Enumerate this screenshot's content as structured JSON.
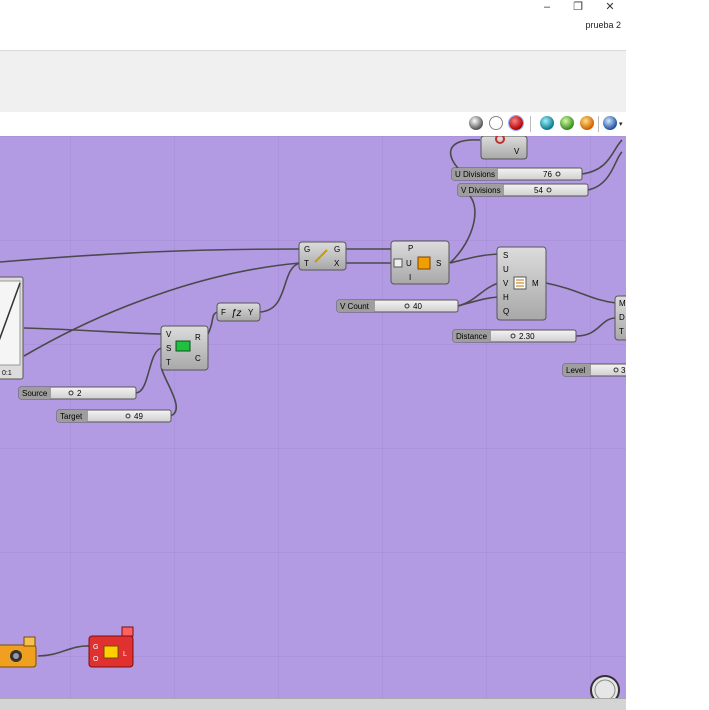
{
  "window": {
    "title": "prueba 2",
    "minimize": "–",
    "restore": "❐",
    "close": "✕"
  },
  "toolbar": {
    "icons": [
      "preview-shaded-icon",
      "preview-wire-icon",
      "preview-selected-icon",
      "bake-icon",
      "material-icon",
      "color-icon",
      "display-icon"
    ]
  },
  "components": {
    "surface_param": {
      "port": "V"
    },
    "u_divisions": {
      "label": "U Divisions",
      "value": "76"
    },
    "v_divisions": {
      "label": "V Divisions",
      "value": "54"
    },
    "evaluate": {
      "in1": "G",
      "in2": "T",
      "out1": "G",
      "out2": "X"
    },
    "divide_surface": {
      "in1": "P",
      "in2": "U",
      "in3": "I",
      "out": "S"
    },
    "mesh_component": {
      "in": [
        "S",
        "U",
        "V",
        "H",
        "Q"
      ],
      "out": "M"
    },
    "v_count": {
      "label": "V Count",
      "value": "40"
    },
    "expression": {
      "in": "F",
      "out": "Y"
    },
    "graph_mapper": {
      "label": "0:1"
    },
    "remap": {
      "in": [
        "V",
        "S",
        "T"
      ],
      "out1": "R",
      "out2": "C"
    },
    "source": {
      "label": "Source",
      "value": "2"
    },
    "target": {
      "label": "Target",
      "value": "49"
    },
    "distance": {
      "label": "Distance",
      "value": "2.30"
    },
    "level": {
      "label": "Level",
      "value": "3"
    },
    "right_component": {
      "in": [
        "M",
        "D",
        "T"
      ]
    },
    "red_component": {
      "in1": "G",
      "in2": "O",
      "out": "L"
    }
  }
}
